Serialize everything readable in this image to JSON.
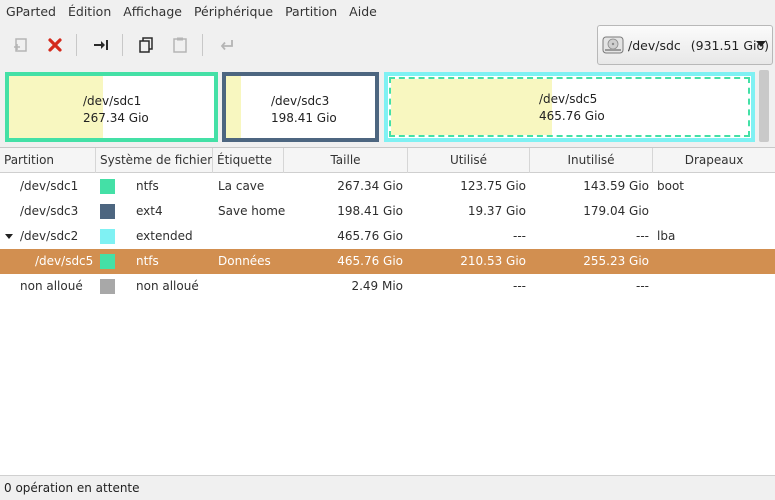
{
  "menu": [
    "GParted",
    "Édition",
    "Affichage",
    "Périphérique",
    "Partition",
    "Aide"
  ],
  "toolbar": {
    "icons": [
      "new-partition-icon",
      "delete-icon",
      "resize-move-icon",
      "copy-icon",
      "paste-icon",
      "undo-icon"
    ]
  },
  "device": {
    "name": "/dev/sdc",
    "size": "(931.51 Gio)"
  },
  "map": {
    "partitions": [
      {
        "name": "/dev/sdc1",
        "size": "267.34 Gio",
        "border": "#44e0a6",
        "used_fraction": 0.46
      },
      {
        "name": "/dev/sdc3",
        "size": "198.41 Gio",
        "border": "#4d6680",
        "used_fraction": 0.1
      },
      {
        "name": "/dev/sdc5",
        "size": "465.76 Gio",
        "border": "#44e0a6",
        "outer": "#7ff1f3",
        "used_fraction": 0.45
      }
    ]
  },
  "columns": [
    "Partition",
    "Système de fichiers",
    "Étiquette",
    "Taille",
    "Utilisé",
    "Inutilisé",
    "Drapeaux"
  ],
  "rows": [
    {
      "partition": "/dev/sdc1",
      "color": "#44e0a6",
      "fs": "ntfs",
      "label": "La cave",
      "size": "267.34 Gio",
      "used": "123.75 Gio",
      "unused": "143.59 Gio",
      "flags": "boot"
    },
    {
      "partition": "/dev/sdc3",
      "color": "#4d6680",
      "fs": "ext4",
      "label": "Save home",
      "size": "198.41 Gio",
      "used": "19.37 Gio",
      "unused": "179.04 Gio",
      "flags": ""
    },
    {
      "partition": "/dev/sdc2",
      "color": "#7ff1f3",
      "fs": "extended",
      "label": "",
      "size": "465.76 Gio",
      "used": "---",
      "unused": "---",
      "flags": "lba"
    },
    {
      "partition": "/dev/sdc5",
      "color": "#44e0a6",
      "fs": "ntfs",
      "label": "Données",
      "size": "465.76 Gio",
      "used": "210.53 Gio",
      "unused": "255.23 Gio",
      "flags": ""
    },
    {
      "partition": "non alloué",
      "color": "#a8a8a8",
      "fs": "non alloué",
      "label": "",
      "size": "2.49 Mio",
      "used": "---",
      "unused": "---",
      "flags": ""
    }
  ],
  "status": "0 opération en attente"
}
